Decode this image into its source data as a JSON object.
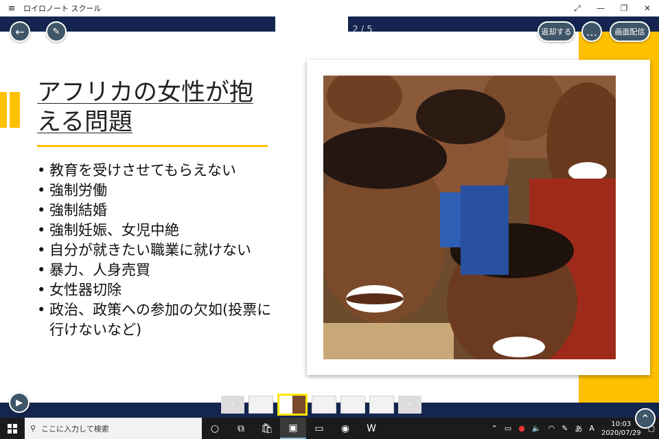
{
  "window": {
    "title": "ロイロノート スクール",
    "controls": [
      "⤢",
      "—",
      "❐",
      "✕"
    ]
  },
  "toolbar": {
    "page_indicator": "2 / 5",
    "return_label": "返却する",
    "more_label": "…",
    "broadcast_label": "画面配信"
  },
  "slide": {
    "title": "アフリカの女性が抱える問題",
    "bullets": [
      "教育を受けさせてもらえない",
      "強制労働",
      "強制結婚",
      "強制妊娠、女児中絶",
      "自分が就きたい職業に就けない",
      "暴力、人身売買",
      "女性器切除",
      "政治、政策への参加の欠如(投票に行けないなど)"
    ],
    "accent_color": "#ffc000",
    "photo_alt": "smiling children"
  },
  "thumbnails": {
    "count": 5,
    "active_index": 1
  },
  "taskbar": {
    "search_placeholder": "ここに入力して検索",
    "ime": "あ",
    "time": "10:03",
    "date": "2020/07/29"
  },
  "colors": {
    "nav": "#14264f",
    "button": "#3f5568"
  }
}
